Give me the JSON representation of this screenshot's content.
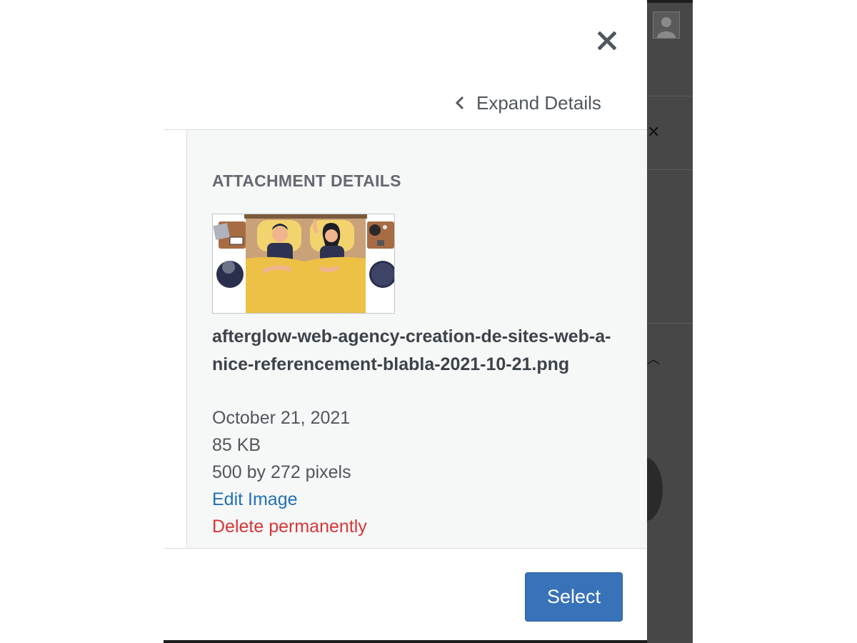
{
  "modal": {
    "close_icon": "close-icon",
    "expand_details": {
      "label": "Expand Details",
      "icon": "chevron-left-icon"
    }
  },
  "attachment": {
    "heading": "ATTACHMENT DETAILS",
    "thumbnail_icon": "image-thumbnail",
    "filename": "afterglow-web-agency-creation-de-sites-web-a-nice-referencement-blabla-2021-10-21.png",
    "date": "October 21, 2021",
    "size": "85 KB",
    "dimensions": "500 by 272 pixels",
    "edit_label": "Edit Image",
    "delete_label": "Delete permanently"
  },
  "footer": {
    "select_label": "Select"
  },
  "colors": {
    "primary": "#3872b8",
    "link": "#2271b1",
    "danger": "#d63638",
    "sidebar_bg": "#f6f7f7"
  }
}
